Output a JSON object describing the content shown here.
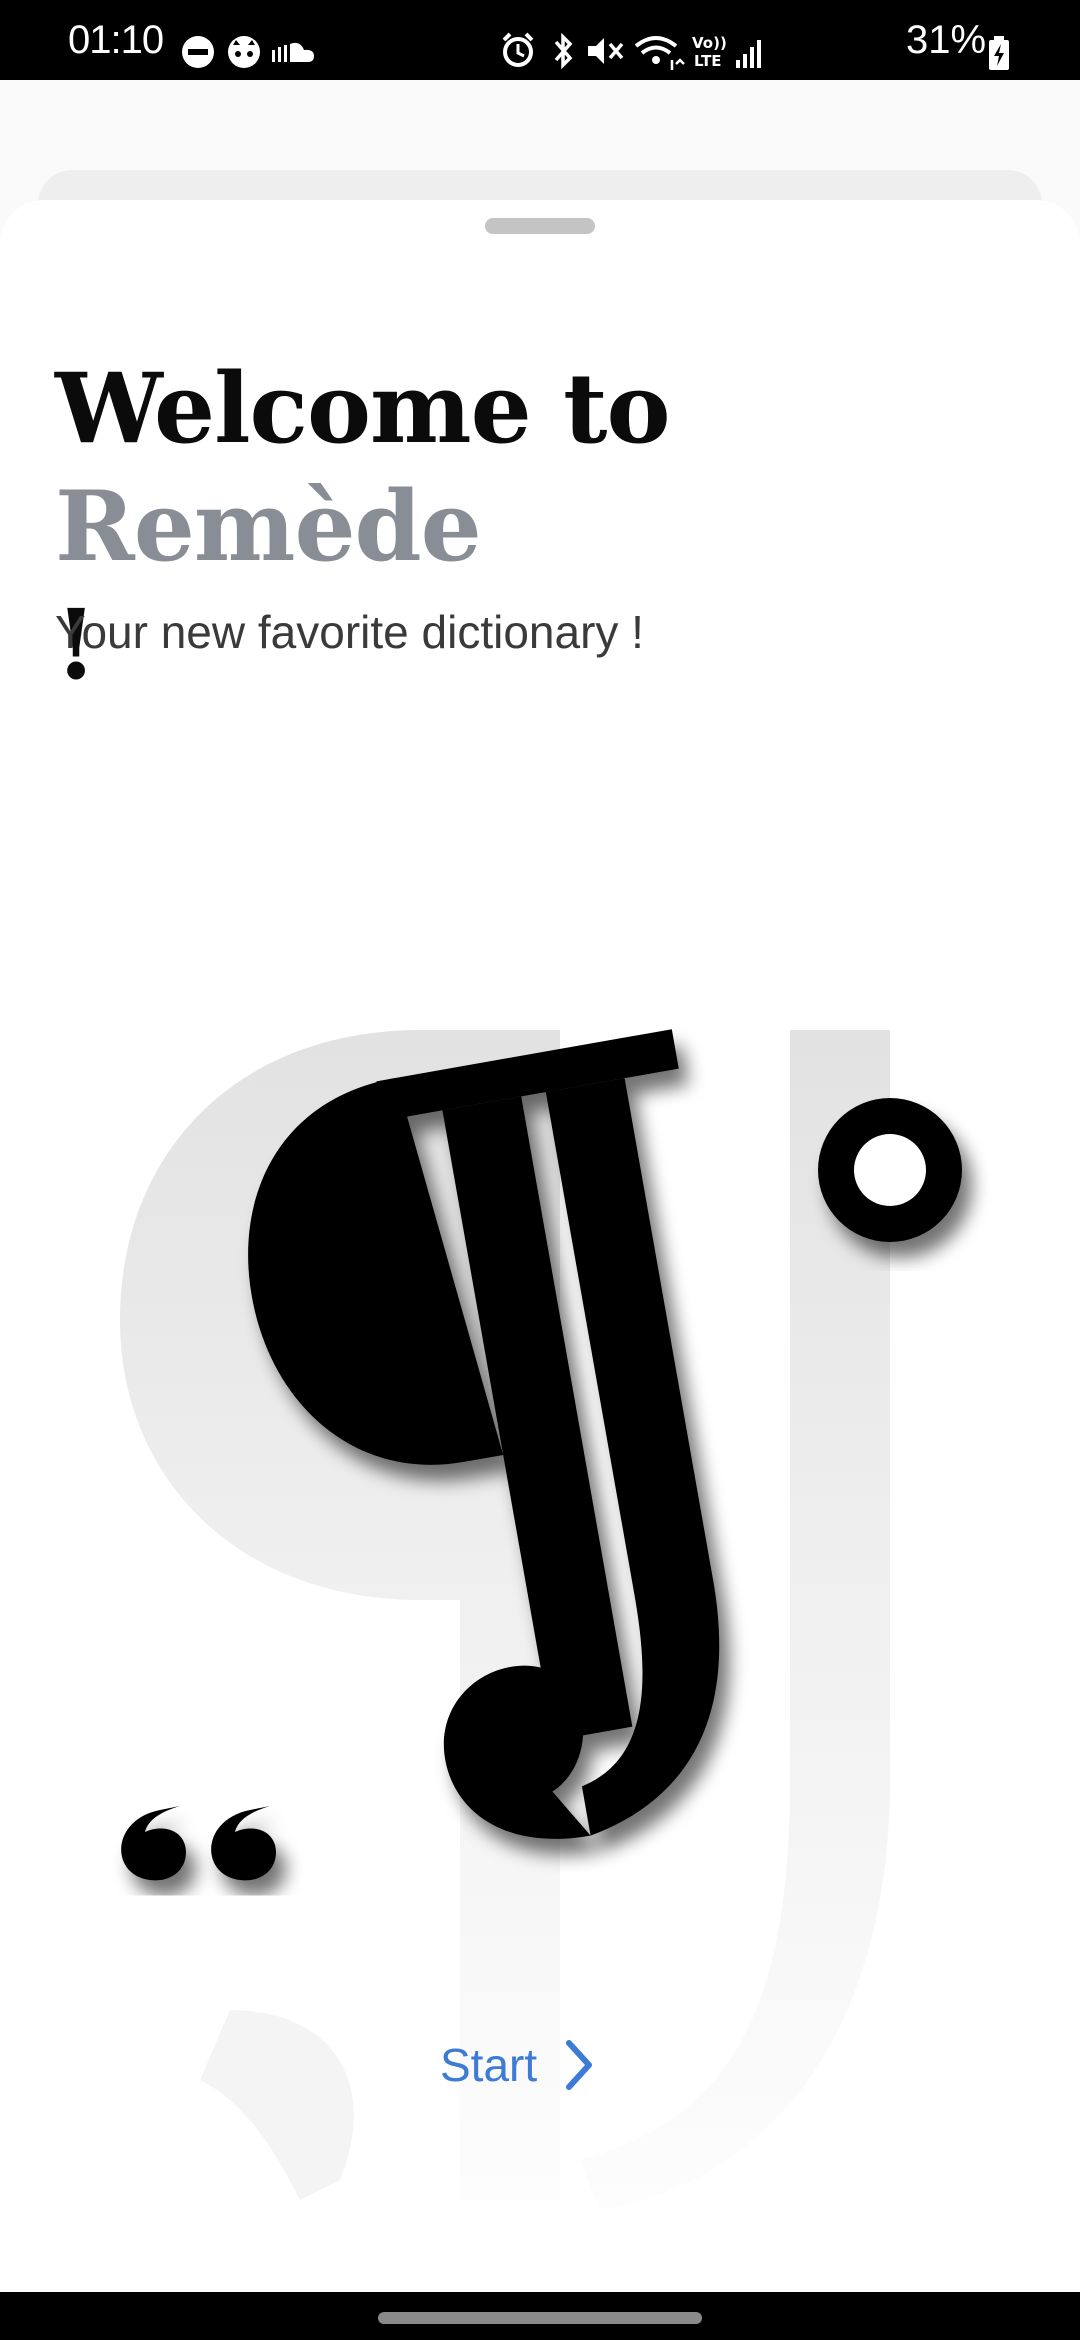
{
  "status_bar": {
    "time": "01:10",
    "battery": "31%"
  },
  "welcome": {
    "title_prefix": "Welcome to ",
    "app_name": "Remède",
    "title_suffix": "!",
    "subtitle": "Your new favorite dictionary !"
  },
  "actions": {
    "start_label": "Start"
  },
  "colors": {
    "accent": "#3d7bd6",
    "app_name": "#898e96",
    "text": "#0b0b0b"
  }
}
